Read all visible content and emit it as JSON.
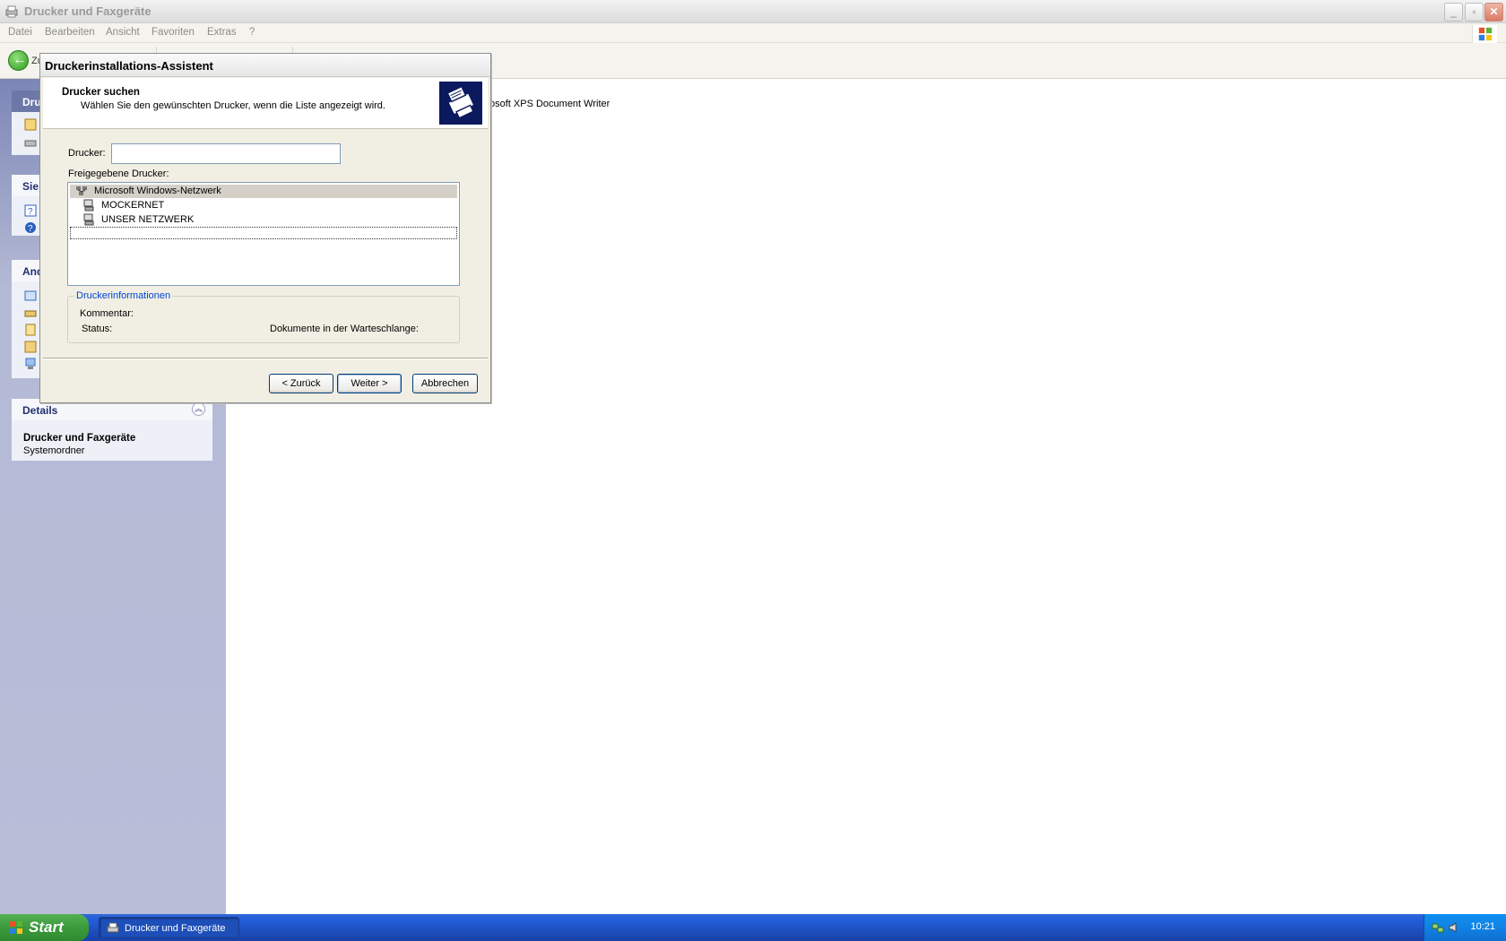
{
  "window": {
    "title": "Drucker und Faxgeräte"
  },
  "menu": [
    "Datei",
    "Bearbeiten",
    "Ansicht",
    "Favoriten",
    "Extras",
    "?"
  ],
  "toolbar": {
    "back_label": "Zu"
  },
  "taskpane": {
    "printer_tasks_title": "Dru",
    "see_also_title": "Sie",
    "other_places_title": "And",
    "details": {
      "header": "Details",
      "name": "Drucker und Faxgeräte",
      "type": "Systemordner"
    }
  },
  "content": {
    "item_partial": "osoft XPS Document Writer"
  },
  "dialog": {
    "title": "Druckerinstallations-Assistent",
    "header_title": "Drucker suchen",
    "header_subtitle": "Wählen Sie den gewünschten Drucker, wenn die Liste angezeigt wird.",
    "printer_label": "Drucker:",
    "printer_value": "",
    "shared_label": "Freigegebene Drucker:",
    "tree": [
      {
        "label": "Microsoft Windows-Netzwerk",
        "level": 0,
        "selected": true
      },
      {
        "label": "MOCKERNET",
        "level": 1,
        "selected": false
      },
      {
        "label": "UNSER NETZWERK",
        "level": 1,
        "selected": false
      }
    ],
    "info_group": "Druckerinformationen",
    "comment_label": "Kommentar:",
    "status_label": "Status:",
    "queue_label": "Dokumente in der Warteschlange:",
    "buttons": {
      "back": "< Zurück",
      "next": "Weiter >",
      "cancel": "Abbrechen"
    }
  },
  "taskbar": {
    "start_label": "Start",
    "task_label": "Drucker und Faxgeräte",
    "clock": "10:21"
  }
}
